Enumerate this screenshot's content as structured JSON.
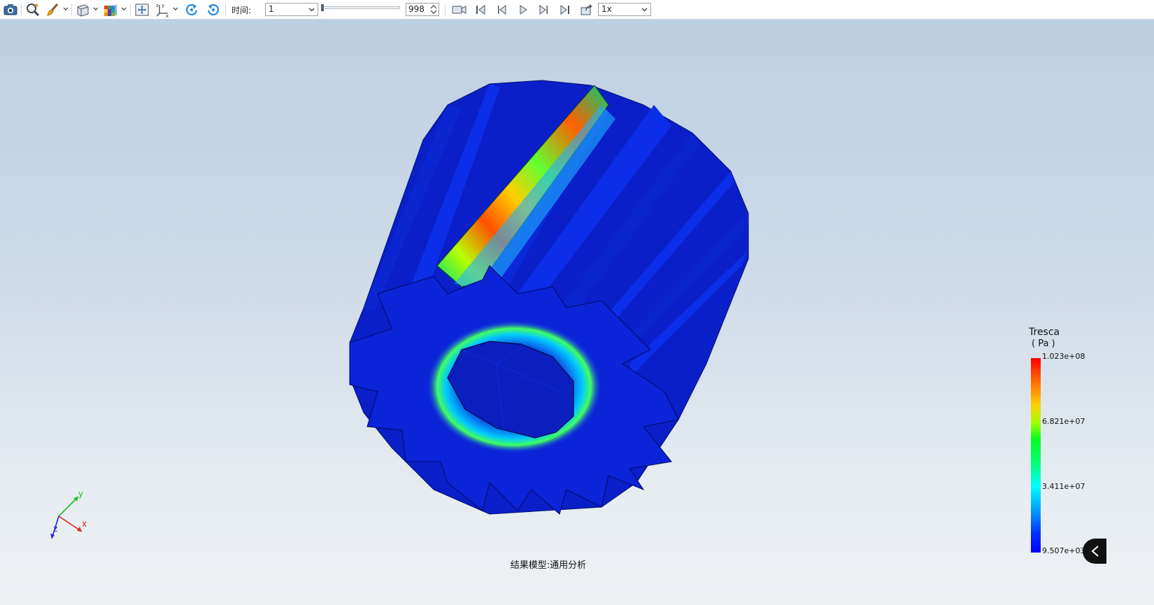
{
  "toolbar": {
    "icons": [
      "camera-icon",
      "zoom-fit-icon",
      "paint-brush-icon",
      "view-cube-icon",
      "display-style-icon",
      "fit-view-icon",
      "axis-triad-icon",
      "rotate-left-icon",
      "rotate-right-icon"
    ],
    "time_label": "时间:",
    "time_value": "1",
    "frame_value": "998",
    "playback_icons": [
      "record-video-icon",
      "first-frame-icon",
      "previous-frame-icon",
      "play-icon",
      "next-frame-icon",
      "last-frame-icon",
      "export-icon"
    ],
    "speed_value": "1x"
  },
  "viewport": {
    "model": "helical-gear",
    "status_text": "结果模型:通用分析",
    "background_top": "#bccfe3",
    "background_bottom": "#eef1f4"
  },
  "triad": {
    "x_label": "x",
    "y_label": "y",
    "z_label": "z"
  },
  "legend": {
    "title": "Tresca",
    "unit": "( Pa )",
    "max": "1.023e+08",
    "mid_high": "6.821e+07",
    "mid_low": "3.411e+07",
    "min": "9.507e+03",
    "colors": [
      "#ff0000",
      "#ffd000",
      "#00ff20",
      "#00ffff",
      "#0000ff"
    ]
  }
}
